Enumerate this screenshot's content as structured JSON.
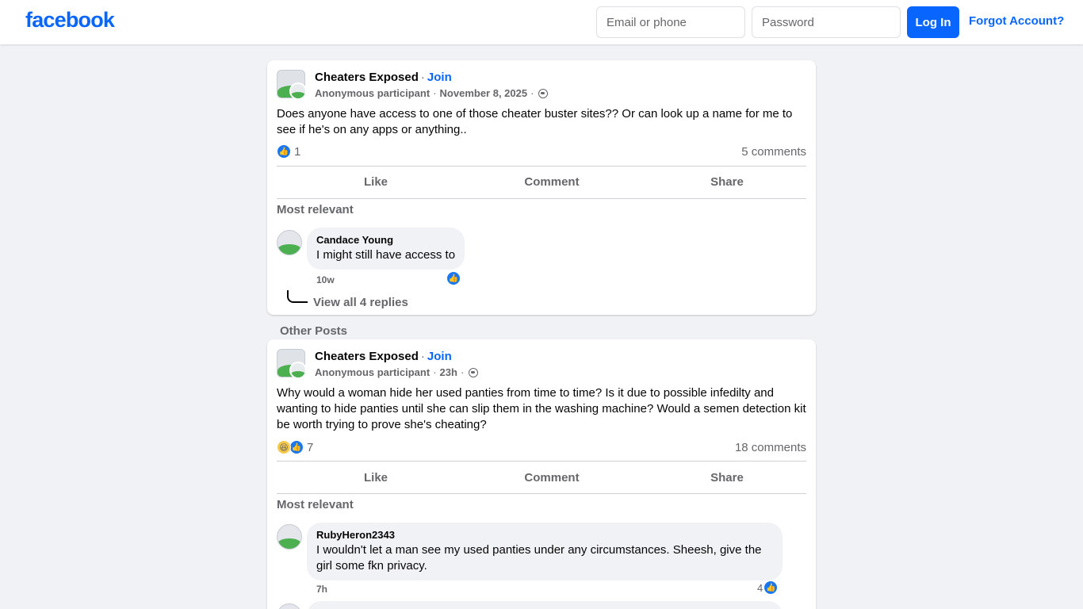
{
  "header": {
    "logo": "facebook",
    "email_placeholder": "Email or phone",
    "password_placeholder": "Password",
    "login_label": "Log In",
    "forgot_label": "Forgot Account?"
  },
  "colors": {
    "brand": "#0866ff",
    "like_blue": "#1877f2",
    "page_bg": "#f0f2f5"
  },
  "posts": [
    {
      "group": "Cheaters Exposed",
      "join": "Join",
      "author": "Anonymous participant",
      "time": "November 8, 2025",
      "text": "Does anyone have access to one of those cheater buster sites?? Or can look up a name for me to see if he's on any apps or anything..",
      "reactions": [
        "like-icon"
      ],
      "reaction_count": "1",
      "comments_count": "5 comments",
      "actions": {
        "like": "Like",
        "comment": "Comment",
        "share": "Share"
      },
      "most_relevant": "Most relevant",
      "comment": {
        "author": "Candace Young",
        "text": "I might still have access to",
        "time": "10w",
        "likes": ""
      },
      "view_replies": "View all 4 replies"
    },
    {
      "group": "Cheaters Exposed",
      "join": "Join",
      "author": "Anonymous participant",
      "time": "23h",
      "text": "Why would a woman hide her used panties from time to time? Is it due to possible infedilty and wanting to hide panties until she can slip them in the washing machine? Would a semen detection kit be worth trying to prove she's cheating?",
      "reactions": [
        "haha-icon",
        "like-icon"
      ],
      "reaction_count": "7",
      "comments_count": "18 comments",
      "actions": {
        "like": "Like",
        "comment": "Comment",
        "share": "Share"
      },
      "most_relevant": "Most relevant",
      "comment": {
        "author": "RubyHeron2343",
        "text": "I wouldn't let a man see my used panties under any circumstances. Sheesh, give the girl some fkn privacy.",
        "time": "7h",
        "likes": "4"
      }
    }
  ],
  "other_posts_label": "Other Posts"
}
